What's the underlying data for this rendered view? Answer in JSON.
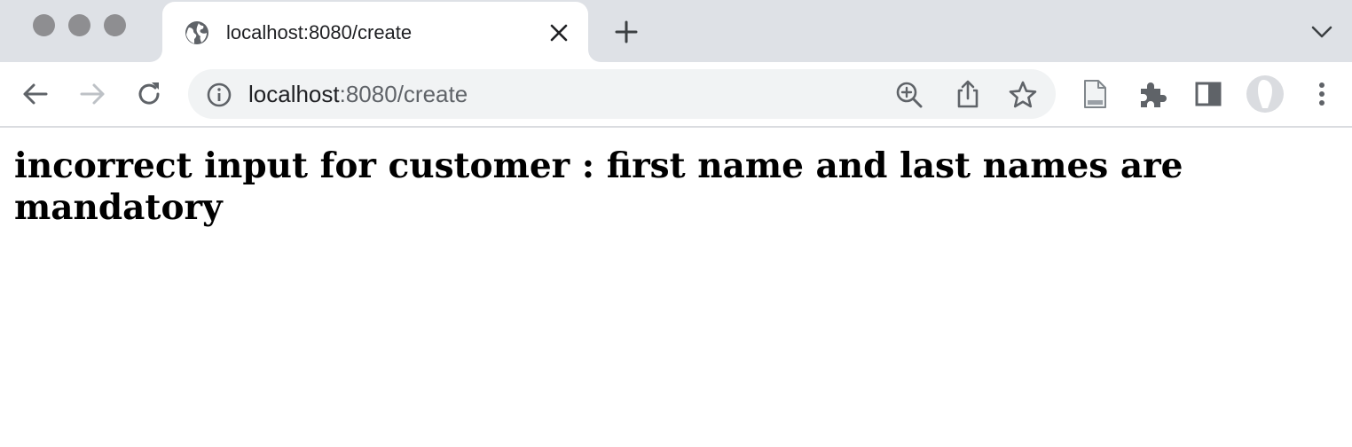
{
  "browser": {
    "tab": {
      "title": "localhost:8080/create",
      "favicon": "globe-icon"
    },
    "address_bar": {
      "host": "localhost",
      "rest": ":8080/create",
      "info_icon": "info-icon"
    },
    "icons": {
      "back": "arrow-left-icon",
      "forward": "arrow-right-icon",
      "reload": "reload-icon",
      "zoom": "zoom-in-icon",
      "share": "share-icon",
      "bookmark": "star-icon",
      "reader": "document-icon",
      "extensions": "puzzle-icon",
      "side_panel": "side-panel-icon",
      "profile": "avatar-icon",
      "menu": "kebab-menu-icon",
      "new_tab": "plus-icon",
      "tab_close": "close-icon",
      "tab_search": "chevron-down-icon"
    },
    "colors": {
      "tab_strip": "#dee1e6",
      "omnibox": "#f1f3f4",
      "icon": "#5f6368",
      "icon_disabled": "#bdc1c6"
    }
  },
  "page": {
    "heading": "incorrect input for customer : first name and last names are mandatory"
  }
}
